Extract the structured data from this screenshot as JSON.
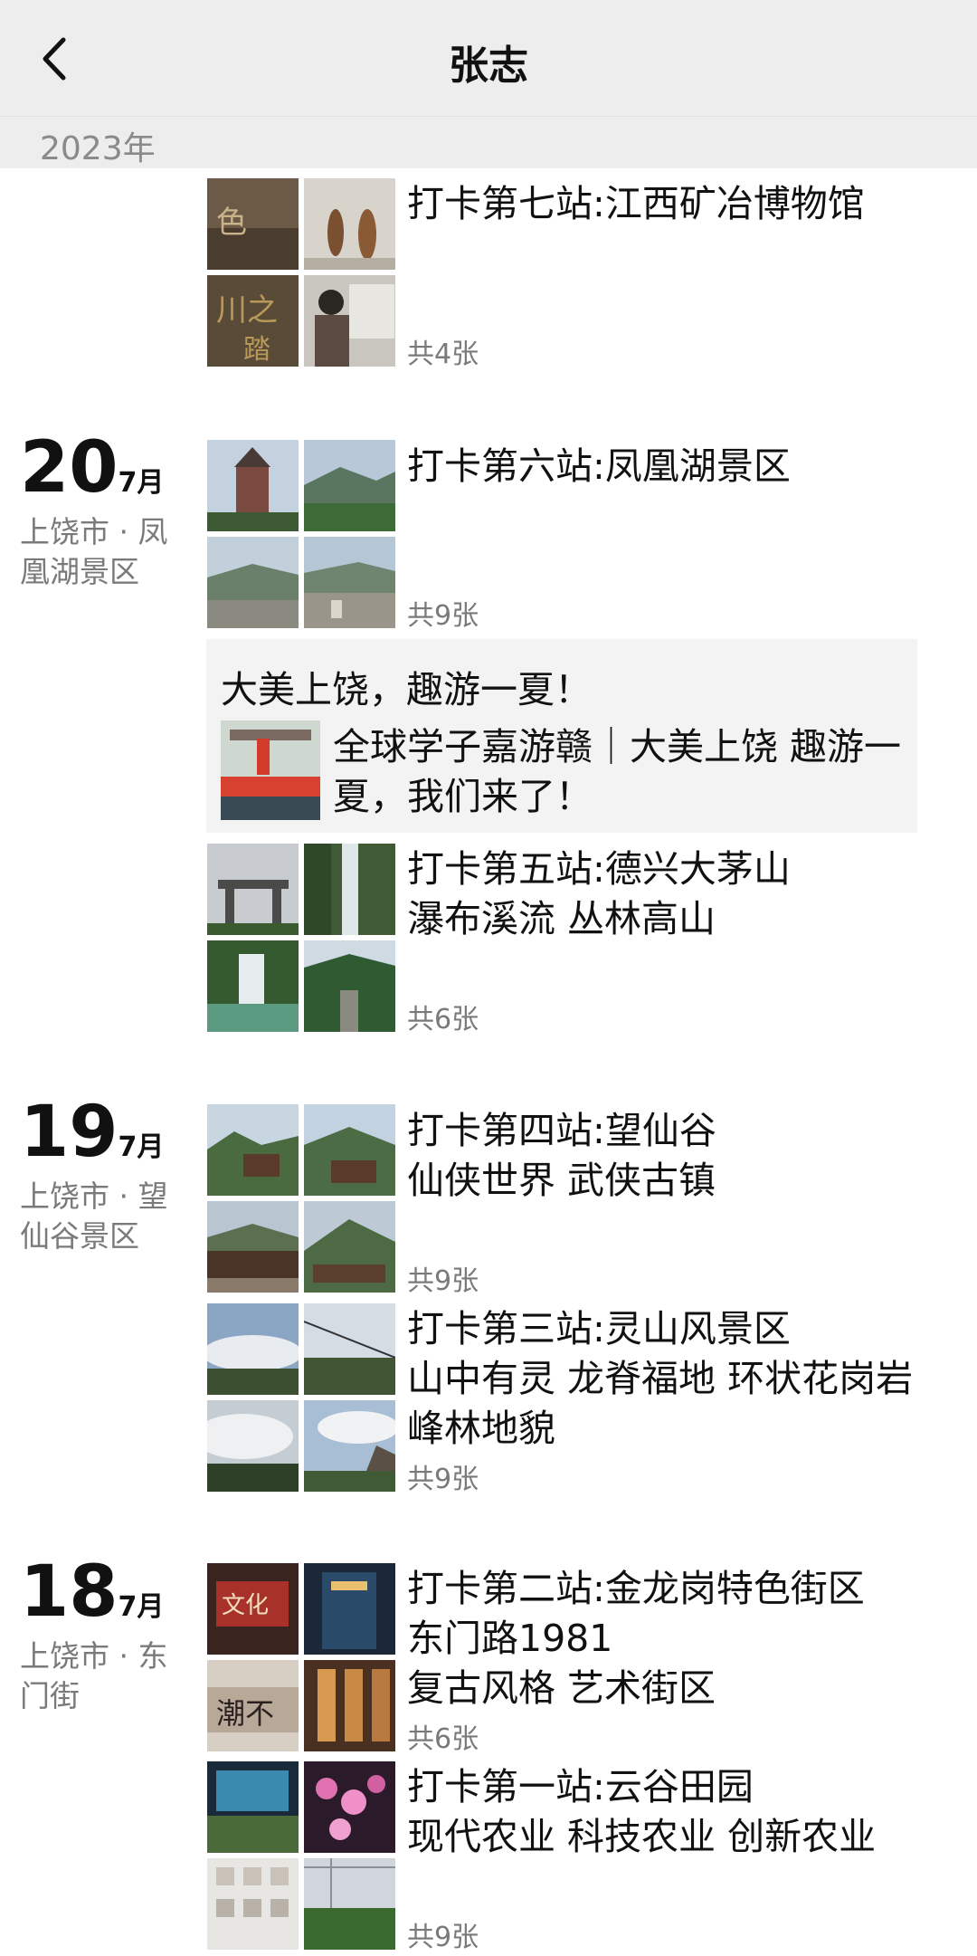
{
  "header": {
    "title": "张志",
    "back_icon": "chevron-left-icon"
  },
  "year_label": "2023年",
  "dates": [
    {
      "day": "20",
      "month": "7月",
      "location": "上饶市 · 凤凰湖景区"
    },
    {
      "day": "19",
      "month": "7月",
      "location": "上饶市 · 望仙谷景区"
    },
    {
      "day": "18",
      "month": "7月",
      "location": "上饶市 · 东门街"
    }
  ],
  "posts": [
    {
      "text": "打卡第七站:江西矿冶博物馆",
      "count": "共4张"
    },
    {
      "text": "打卡第六站:凤凰湖景区",
      "count": "共9张"
    },
    {
      "text": "打卡第五站:德兴大茅山\n瀑布溪流 丛林高山",
      "count": "共6张"
    },
    {
      "text": "打卡第四站:望仙谷\n仙侠世界 武侠古镇",
      "count": "共9张"
    },
    {
      "text": "打卡第三站:灵山风景区\n山中有灵  龙脊福地  环状花岗岩峰林地貌",
      "count": "共9张"
    },
    {
      "text": "打卡第二站:金龙岗特色街区\n 东门路1981\n复古风格 艺术街区",
      "count": "共6张"
    },
    {
      "text": "打卡第一站:云谷田园\n现代农业 科技农业 创新农业",
      "count": "共9张"
    }
  ],
  "shared_article": {
    "title": "大美上饶，趣游一夏！",
    "description": "全球学子嘉游赣｜大美上饶 趣游一夏，我们来了！"
  }
}
